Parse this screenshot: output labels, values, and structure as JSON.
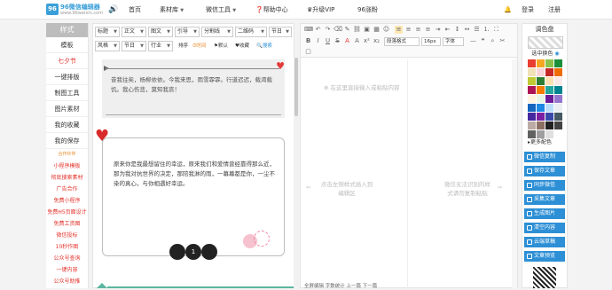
{
  "header": {
    "logo_text": "96微信编辑器",
    "logo_sub": "www.96weixin.com",
    "nav": [
      "首页",
      "素材库",
      "微信工具",
      "帮助中心",
      "升级VIP",
      "96涨粉"
    ],
    "login": "登录",
    "register": "注册"
  },
  "left": {
    "head": "样式",
    "items": [
      "模板",
      "七夕节",
      "一键排版",
      "制图工具",
      "图片素材",
      "我的收藏",
      "我的保存"
    ],
    "subs": [
      "合作伙伴",
      "小程序模板",
      "彻底搜索素材",
      "广告合作",
      "免费小程序",
      "免费H5页面设计",
      "免费工资图",
      "微信投标",
      "10秒作图",
      "公众号查询",
      "一键内容",
      "公众号助推"
    ]
  },
  "filters": {
    "row1": [
      "标题",
      "正文",
      "图文",
      "引导",
      "分割线",
      "二维码",
      "节日"
    ],
    "row2": [
      "风格",
      "节日",
      "行业"
    ],
    "sort_label": "排序",
    "sort_opts": [
      "时间",
      "默认",
      "收藏"
    ],
    "search": "搜索"
  },
  "card1_text": "昔我往矣，杨柳依依。今我来思，雨雪霏霏。行道迟迟，载渴载饥。我心伤悲，莫知我哀！",
  "card2_text": "原来你是我最想留住的幸运，原来我们和爱情曾经靠得那么近，那为我对抗世界的决定，那陪我淋的雨，一幕幕都是你，一尘不染的真心，与你相遇好幸运。",
  "pagination": "1",
  "editor": {
    "toolbar_sel": [
      "段落格式",
      "16px",
      "字体"
    ],
    "placeholder_main": "在这里直接输入或粘贴内容",
    "placeholder_left": "点击左侧样式插入到编辑区",
    "placeholder_right": "微信无法识别的样式请勿复制粘贴",
    "bottom_bar": "全屏编辑   字数统计   上一篇   下一篇"
  },
  "right": {
    "head": "调色盘",
    "select_color": "选中换色",
    "more_colors": "更多配色",
    "buttons": [
      "微信复制",
      "保存文章",
      "同步微信",
      "采集文章",
      "生成图片",
      "清空内容",
      "云端草稿",
      "文章预览"
    ],
    "swatches": [
      "#e83d2f",
      "#f6a623",
      "#8bc34a",
      "#1b8f3a",
      "#f0e1b8",
      "#f8d5d8",
      "#c62828",
      "#ef6c00",
      "#c0ca33",
      "#2e7d32",
      "#ffe0b2",
      "#fbe9e7",
      "#ad1457",
      "#f57c00",
      "#26a69a",
      "#00838f",
      "#fff3e0",
      "#e8f5e9",
      "#6a1b9a",
      "#9575cd",
      "#1565c0",
      "#1e88e5",
      "#bbdefb",
      "#eceff1",
      "#4527a0",
      "#7b1fa2",
      "#3949ab",
      "#455a64",
      "#bcaaa4",
      "#8d6e63",
      "#212121",
      "#424242",
      "#616161",
      "#9e9e9e",
      "#e0e0e0",
      "#ffffff"
    ]
  }
}
